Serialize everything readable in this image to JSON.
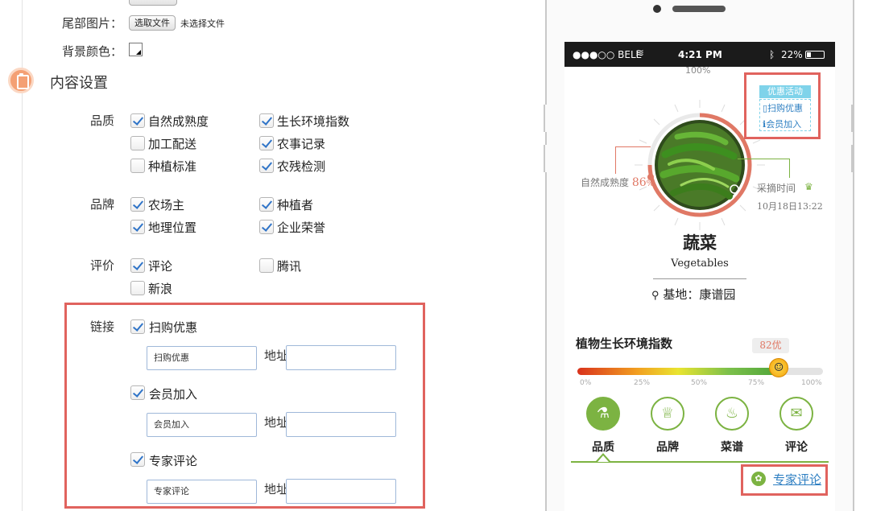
{
  "settings": {
    "footer_image_label": "尾部图片：",
    "file_button": "选取文件",
    "file_status": "未选择文件",
    "bg_color_label": "背景颜色：",
    "section_title": "内容设置",
    "groups": {
      "quality": {
        "label": "品质",
        "options": [
          {
            "label": "自然成熟度",
            "checked": true
          },
          {
            "label": "生长环境指数",
            "checked": true
          },
          {
            "label": "加工配送",
            "checked": false
          },
          {
            "label": "农事记录",
            "checked": true
          },
          {
            "label": "种植标准",
            "checked": false
          },
          {
            "label": "农残检测",
            "checked": true
          }
        ]
      },
      "brand": {
        "label": "品牌",
        "options": [
          {
            "label": "农场主",
            "checked": true
          },
          {
            "label": "种植者",
            "checked": true
          },
          {
            "label": "地理位置",
            "checked": true
          },
          {
            "label": "企业荣誉",
            "checked": true
          }
        ]
      },
      "review": {
        "label": "评价",
        "options": [
          {
            "label": "评论",
            "checked": true
          },
          {
            "label": "腾讯",
            "checked": false
          },
          {
            "label": "新浪",
            "checked": false
          }
        ]
      },
      "links": {
        "label": "链接",
        "address_label": "地址",
        "items": [
          {
            "label": "扫购优惠",
            "checked": true,
            "name_value": "扫购优惠",
            "address_value": ""
          },
          {
            "label": "会员加入",
            "checked": true,
            "name_value": "会员加入",
            "address_value": ""
          },
          {
            "label": "专家评论",
            "checked": true,
            "name_value": "专家评论",
            "address_value": ""
          }
        ]
      }
    }
  },
  "phone": {
    "status": {
      "carrier": "●●●○○ BELL",
      "time": "4:21 PM",
      "battery": "22%"
    },
    "top_percent": "100%",
    "promo": {
      "title": "优惠活动",
      "scan": "扫购优惠",
      "member": "会员加入"
    },
    "maturity_label": "自然成熟度",
    "maturity_value": 86,
    "maturity_unit": "%",
    "harvest_label": "采摘时间",
    "harvest_time": "10月18日13:22",
    "product_name": "蔬菜",
    "product_name_en": "Vegetables",
    "base_label": "基地：康谱园",
    "env_title": "植物生长环境指数",
    "env_score": 82,
    "env_badge": "82优",
    "ticks": [
      "0%",
      "25%",
      "50%",
      "75%",
      "100%"
    ],
    "tabs": [
      "品质",
      "品牌",
      "菜谱",
      "评论"
    ],
    "expert_link": "专家评论",
    "colors": {
      "accent": "#7cb342",
      "highlight": "#e0635e",
      "promo": "#7fd3ea"
    }
  }
}
